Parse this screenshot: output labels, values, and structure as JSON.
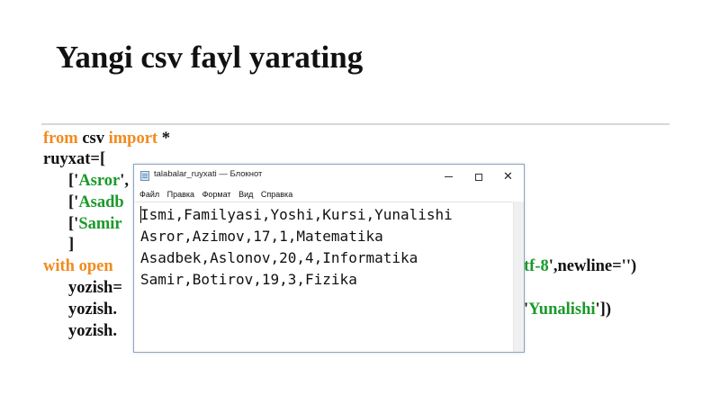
{
  "slide": {
    "title": "Yangi csv fayl yarating"
  },
  "code": {
    "l1": {
      "kw1": "from",
      "mid": " csv ",
      "kw2": "import",
      "end": " *"
    },
    "l2": "ruyxat=[",
    "l3": {
      "open": "['",
      "str": "Asror",
      "close": "',"
    },
    "l4": {
      "open": "['",
      "str": "Asadb",
      "close": ""
    },
    "l5": {
      "open": "['",
      "str": "Samir",
      "close": ""
    },
    "l6": "]",
    "l7": {
      "kw": "with",
      "txt": " open",
      "str_right": "tf-8",
      "tail": "',newline='')"
    },
    "l8": "yozish=",
    "l9": {
      "left": "yozish.",
      "str_right": "Yunalishi",
      "tail": "'])"
    },
    "l10": "yozish."
  },
  "notepad": {
    "title": "talabalar_ruyxati — Блокнот",
    "menu": [
      "Файл",
      "Правка",
      "Формат",
      "Вид",
      "Справка"
    ],
    "lines": [
      "Ismi,Familyasi,Yoshi,Kursi,Yunalishi",
      "Asror,Azimov,17,1,Matematika",
      "Asadbek,Aslonov,20,4,Informatika",
      "Samir,Botirov,19,3,Fizika"
    ],
    "controls": {
      "close_glyph": "✕"
    }
  }
}
